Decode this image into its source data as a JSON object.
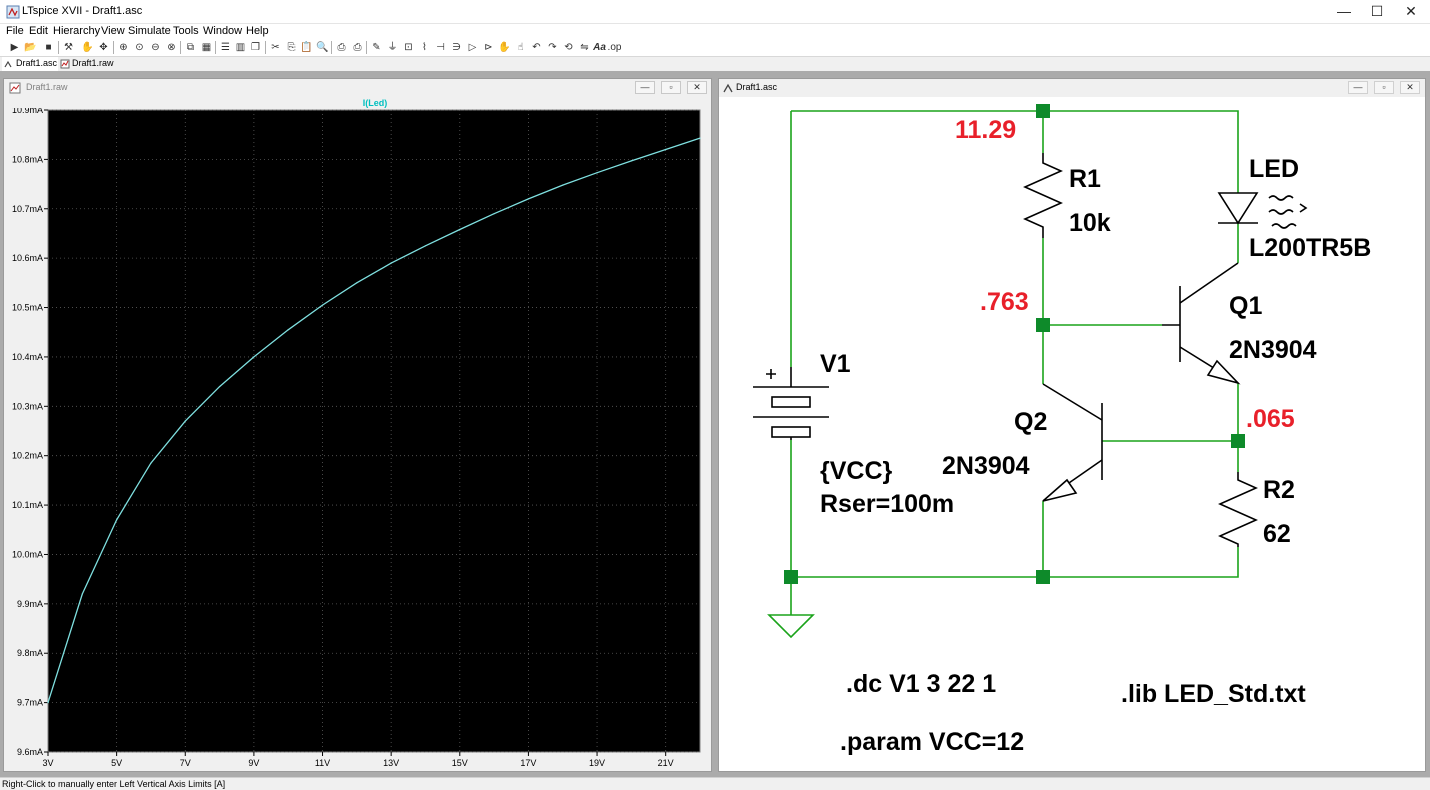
{
  "window": {
    "title": "LTspice XVII - Draft1.asc",
    "controls": [
      "—",
      "☐",
      "✕"
    ]
  },
  "menu": [
    "File",
    "Edit",
    "Hierarchy",
    "View",
    "Simulate",
    "Tools",
    "Window",
    "Help"
  ],
  "toolbar_icons": [
    "run-icon",
    "open-icon",
    "save-icon",
    "control-panel-icon",
    "halt-icon",
    "pan-icon",
    "zoom-in-icon",
    "zoom-fit-icon",
    "zoom-out-icon",
    "zoom-cancel-icon",
    "autorange-icon",
    "grid-icon",
    "tile-horizontal-icon",
    "tile-vertical-icon",
    "cascade-icon",
    "cut-icon",
    "copy-icon",
    "paste-icon",
    "find-icon",
    "print-icon",
    "print-setup-icon",
    "pencil-icon",
    "ground-icon",
    "label-net-icon",
    "resistor-icon",
    "capacitor-icon",
    "inductor-icon",
    "diode-icon",
    "component-icon",
    "move-icon",
    "drag-icon",
    "undo-icon",
    "redo-icon",
    "rotate-icon",
    "mirror-icon",
    "text-icon",
    "spice-directive-icon"
  ],
  "doc_tabs": [
    {
      "label": "Draft1.asc",
      "icon": "schematic-icon",
      "active": true
    },
    {
      "label": "Draft1.raw",
      "icon": "waveform-icon",
      "active": false
    }
  ],
  "plot_window": {
    "title": "Draft1.raw",
    "trace_label": "I(Led)",
    "controls": [
      "—",
      "▫",
      "✕"
    ]
  },
  "schematic_window": {
    "title": "Draft1.asc",
    "controls": [
      "—",
      "▫",
      "✕"
    ],
    "node_voltages": {
      "top": "11.29",
      "base_q1": ".763",
      "emitter_q1": ".065"
    },
    "components": {
      "r1_name": "R1",
      "r1_value": "10k",
      "led_name": "LED",
      "led_value": "L200TR5B",
      "q1_name": "Q1",
      "q1_value": "2N3904",
      "q2_name": "Q2",
      "q2_value": "2N3904",
      "v1_name": "V1",
      "v1_value": "{VCC}",
      "v1_rser": "Rser=100m",
      "r2_name": "R2",
      "r2_value": "62"
    },
    "directives": {
      "dc": ".dc V1 3 22 1",
      "lib": ".lib LED_Std.txt",
      "param": ".param VCC=12"
    }
  },
  "status": "Right-Click to manually enter Left Vertical Axis Limits [A]",
  "colors": {
    "trace": "#7fe0e0",
    "plot_bg": "#000000",
    "wire": "#1aa31a",
    "node_value": "#e8202a",
    "junction": "#0e8a2a"
  },
  "chart_data": {
    "type": "line",
    "title": "I(Led)",
    "xlabel": "",
    "ylabel": "",
    "x_ticks": [
      "3V",
      "5V",
      "7V",
      "9V",
      "11V",
      "13V",
      "15V",
      "17V",
      "19V",
      "21V"
    ],
    "y_ticks": [
      "9.6mA",
      "9.7mA",
      "9.8mA",
      "9.9mA",
      "10.0mA",
      "10.1mA",
      "10.2mA",
      "10.3mA",
      "10.4mA",
      "10.5mA",
      "10.6mA",
      "10.7mA",
      "10.8mA",
      "10.9mA"
    ],
    "xlim": [
      3,
      22
    ],
    "ylim": [
      9.6,
      10.9
    ],
    "grid": true,
    "series": [
      {
        "name": "I(Led)",
        "x": [
          3,
          4,
          5,
          6,
          7,
          8,
          9,
          10,
          11,
          12,
          13,
          14,
          15,
          16,
          17,
          18,
          19,
          20,
          21,
          22
        ],
        "y": [
          9.7,
          9.92,
          10.07,
          10.185,
          10.27,
          10.34,
          10.4,
          10.455,
          10.505,
          10.55,
          10.59,
          10.625,
          10.658,
          10.69,
          10.72,
          10.748,
          10.773,
          10.797,
          10.82,
          10.843
        ]
      }
    ]
  }
}
